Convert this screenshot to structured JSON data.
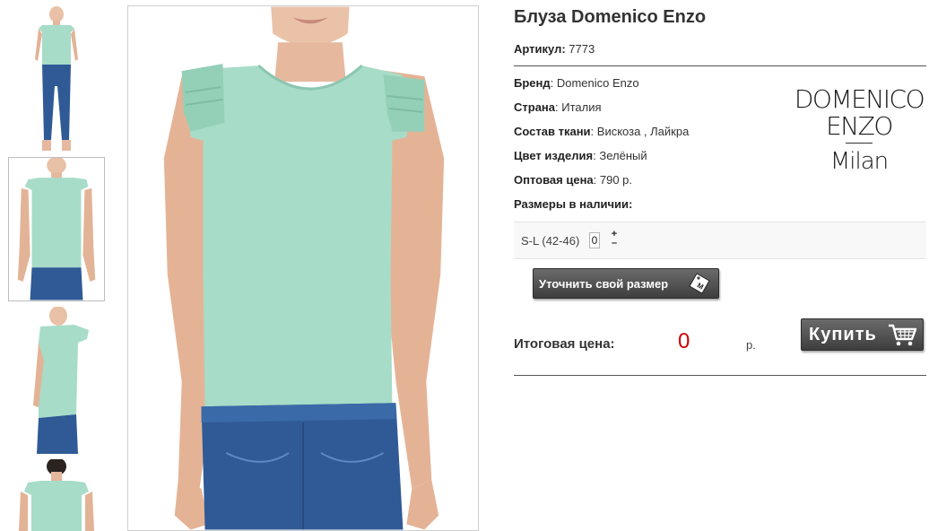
{
  "product": {
    "title": "Блуза Domenico Enzo",
    "article_label": "Артикул:",
    "article_value": " 7773"
  },
  "specs": [
    {
      "label": "Бренд",
      "value": ": Domenico Enzo"
    },
    {
      "label": "Страна",
      "value": ": Италия"
    },
    {
      "label": "Состав ткани",
      "value": ": Вискоза , Лайкра"
    },
    {
      "label": "Цвет изделия",
      "value": ": Зелёный"
    },
    {
      "label": "Оптовая цена",
      "value": ": 790 р."
    },
    {
      "label": "Размеры в наличии:",
      "value": ""
    }
  ],
  "brand_logo": {
    "line1": "DOMENICO",
    "line2": "ENZO",
    "line3": "Milan"
  },
  "sizes": {
    "label": "S-L (42-46)",
    "quantity": "0",
    "plus": "+",
    "minus": "–"
  },
  "buttons": {
    "size_label": "Уточнить свой размер",
    "size_icon": "size-tag-icon",
    "buy_label": "Купить",
    "buy_icon": "shopping-cart-icon"
  },
  "total": {
    "label": "Итоговая цена:",
    "value": "0",
    "currency": "р."
  },
  "colors": {
    "blouse": "#a7dcc8",
    "jeans": "#2f5a96",
    "price": "#cc0000",
    "button": "#4a4a4a"
  }
}
